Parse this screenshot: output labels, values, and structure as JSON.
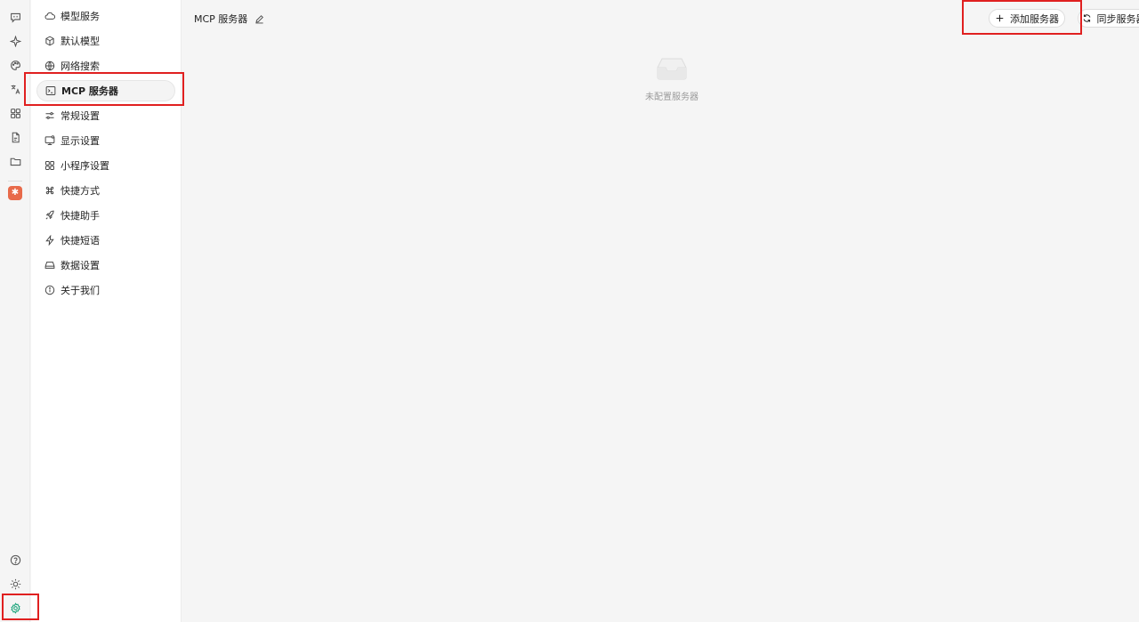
{
  "rail": {
    "icons": [
      "chat-icon",
      "sparkle-icon",
      "palette-icon",
      "translate-icon",
      "grid-icon",
      "document-icon",
      "folder-icon"
    ],
    "bottom_icons": [
      "help-icon",
      "sun-icon",
      "gear-icon"
    ],
    "accent": "#1aa37a",
    "mini_app_color": "#e86a4a"
  },
  "menu": {
    "items": [
      {
        "label": "模型服务",
        "icon": "cloud-icon"
      },
      {
        "label": "默认模型",
        "icon": "cube-icon"
      },
      {
        "label": "网络搜索",
        "icon": "globe-icon"
      },
      {
        "label": "MCP 服务器",
        "icon": "terminal-icon",
        "active": true
      },
      {
        "label": "常规设置",
        "icon": "sliders-icon"
      },
      {
        "label": "显示设置",
        "icon": "monitor-icon"
      },
      {
        "label": "小程序设置",
        "icon": "apps-icon"
      },
      {
        "label": "快捷方式",
        "icon": "command-icon"
      },
      {
        "label": "快捷助手",
        "icon": "rocket-icon"
      },
      {
        "label": "快捷短语",
        "icon": "zap-icon"
      },
      {
        "label": "数据设置",
        "icon": "drive-icon"
      },
      {
        "label": "关于我们",
        "icon": "info-icon"
      }
    ]
  },
  "main": {
    "title": "MCP 服务器",
    "add_button": "添加服务器",
    "sync_button": "同步服务器",
    "empty_text": "未配置服务器"
  },
  "highlight_color": "#e02020"
}
